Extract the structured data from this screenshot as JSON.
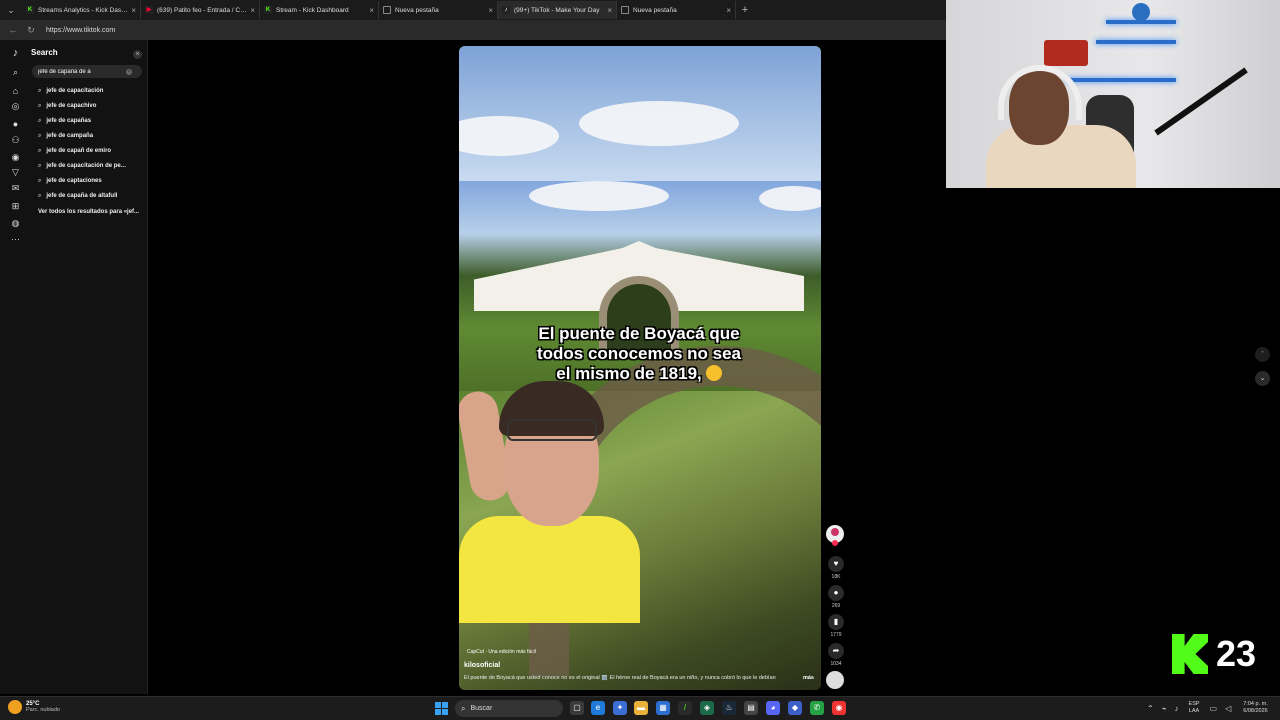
{
  "browser": {
    "tabs": [
      {
        "title": "Streams Analytics - Kick Dashboard",
        "color": "#53fc18",
        "glyph": "K",
        "active": false
      },
      {
        "title": "(639) Patito feo - Entrada / Cabeza",
        "color": "#ff0033",
        "glyph": "▶",
        "active": false
      },
      {
        "title": "Stream - Kick Dashboard",
        "color": "#53fc18",
        "glyph": "K",
        "active": false
      },
      {
        "title": "Nueva pestaña",
        "color": "#888888",
        "glyph": "",
        "active": false
      },
      {
        "title": "(99+) TikTok - Make Your Day",
        "color": "#ffffff",
        "glyph": "♪",
        "active": true
      },
      {
        "title": "Nueva pestaña",
        "color": "#888888",
        "glyph": "",
        "active": false
      }
    ],
    "url": "https://www.tiktok.com"
  },
  "search": {
    "title": "Search",
    "query": "jefe de capaña de a",
    "suggestions": [
      "jefe de capacitación",
      "jefe de capachivo",
      "jefe de capañas",
      "jefe de campaña",
      "jefe de capañ de emiro",
      "jefe de capacitación de pe...",
      "jefe de captaciones",
      "jefe de capaña de altafull"
    ],
    "view_all": "Ver todos los resultados para «jef..."
  },
  "video": {
    "caption_line1": "El puente de Boyacá que",
    "caption_line2": "todos conocemos no sea",
    "caption_line3": "el mismo de 1819,",
    "capcut": "CapCut · Una edición más fácil",
    "author": "kilosoficial",
    "description": "El puente de Boyacá que usted conoce no es el original 🏛️ El héroe real de Boyacá era un niño, y nunca cobró lo que le debían",
    "more": "más"
  },
  "actions": {
    "likes": "18K",
    "comments": "269",
    "saves": "1779",
    "shares": "1034"
  },
  "kick": {
    "viewers": "23"
  },
  "taskbar": {
    "temp": "25°C",
    "weather": "Parc. nublado",
    "search": "Buscar",
    "lang1": "ESP",
    "lang2": "LAA",
    "time": "7:04 p. m.",
    "date": "6/08/2026"
  }
}
